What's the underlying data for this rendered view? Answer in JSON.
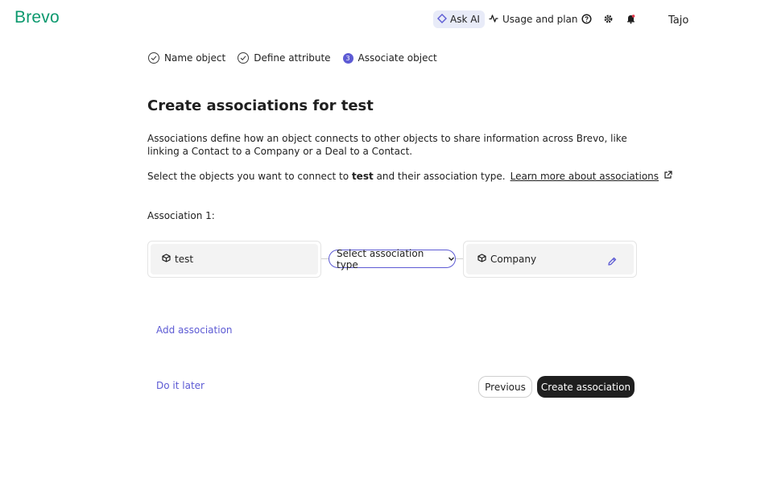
{
  "header": {
    "logo": "Brevo",
    "ask_ai": {
      "label": "Ask AI",
      "icon": "sparkle-diamond-icon"
    },
    "usage": {
      "label": "Usage and plan",
      "icon": "activity-icon"
    },
    "icons": [
      "help-icon",
      "gear-icon",
      "bell-icon"
    ],
    "user_name": "Tajo"
  },
  "stepper": {
    "steps": [
      {
        "label": "Name object",
        "state": "done"
      },
      {
        "label": "Define attribute",
        "state": "done"
      },
      {
        "label": "Associate object",
        "state": "current",
        "number": "3"
      }
    ]
  },
  "main": {
    "title": "Create associations for test",
    "description": "Associations define how an object connects to other objects to share information across Brevo, like linking a Contact to a Company or a Deal to a Contact.",
    "select_prefix": "Select the objects you want to connect to",
    "select_object": "test",
    "select_suffix": "and their association type.",
    "learn_more": "Learn more about associations",
    "association_label": "Association 1:",
    "source_object": "test",
    "association_type_placeholder": "Select association type",
    "target_object": "Company",
    "add_association": "Add association"
  },
  "footer": {
    "do_later": "Do it later",
    "previous": "Previous",
    "create": "Create association"
  },
  "colors": {
    "brand_green": "#0b996e",
    "accent_purple": "#5d5bd4",
    "primary_button": "#1f1f1f"
  }
}
